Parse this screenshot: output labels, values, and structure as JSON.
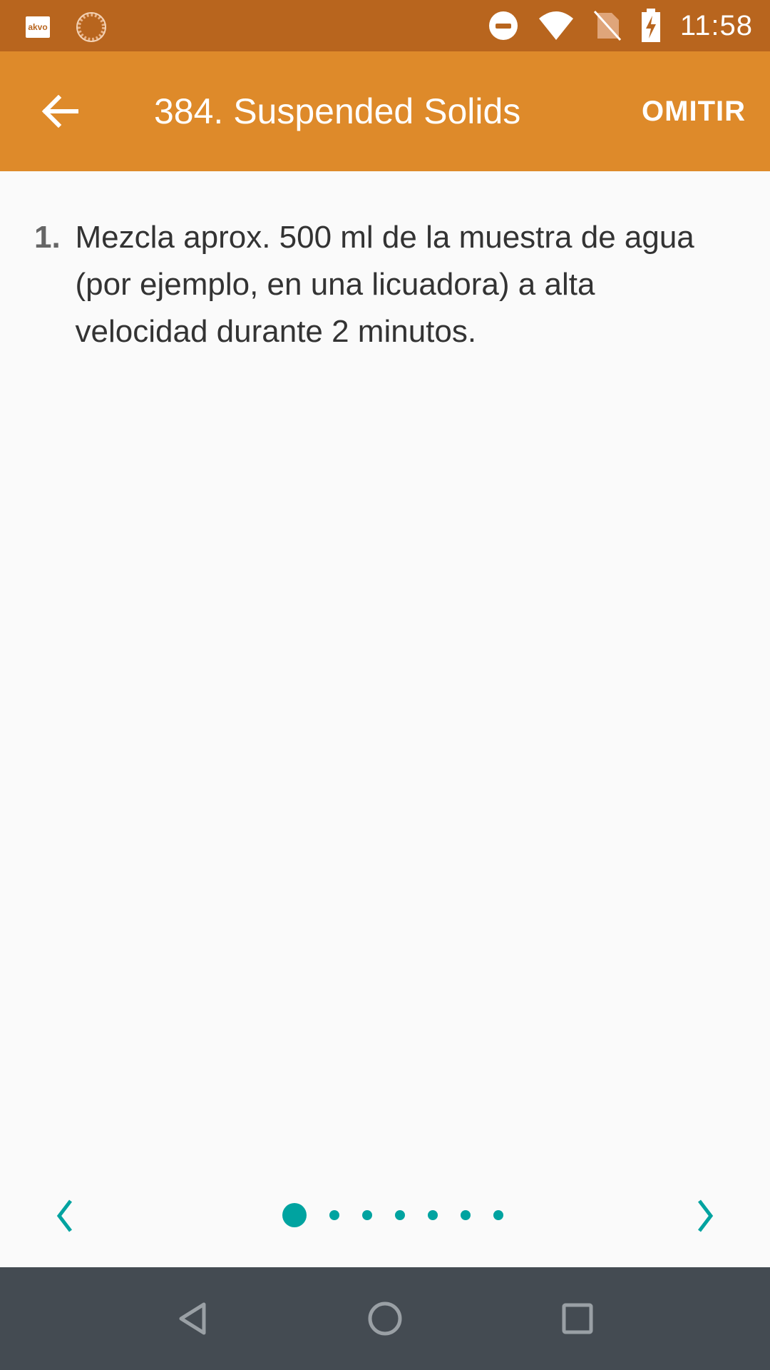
{
  "status_bar": {
    "notification_icons": [
      "akvo-icon",
      "sync-spinner-icon"
    ],
    "akvo_label": "akvo",
    "system_icons": [
      "do-not-disturb-icon",
      "wifi-icon",
      "no-sim-icon",
      "battery-charging-icon"
    ],
    "time": "11:58"
  },
  "app_bar": {
    "back_icon": "arrow-back-icon",
    "title": "384. Suspended Solids",
    "skip_label": "OMITIR"
  },
  "instructions": [
    {
      "number": "1.",
      "text": "Mezcla aprox. 500 ml de la muestra de agua (por ejemplo, en una licuadora) a alta velocidad durante 2 minutos."
    }
  ],
  "pager": {
    "prev_icon": "chevron-left-icon",
    "next_icon": "chevron-right-icon",
    "total_pages": 7,
    "current_page": 1
  },
  "nav_bar": {
    "buttons": [
      "back-triangle-icon",
      "home-circle-icon",
      "recents-square-icon"
    ]
  },
  "colors": {
    "status_bar": "#b8651e",
    "app_bar": "#de8a2a",
    "accent": "#00a3a0",
    "nav_bar": "#444b52",
    "background": "#fafafa"
  }
}
